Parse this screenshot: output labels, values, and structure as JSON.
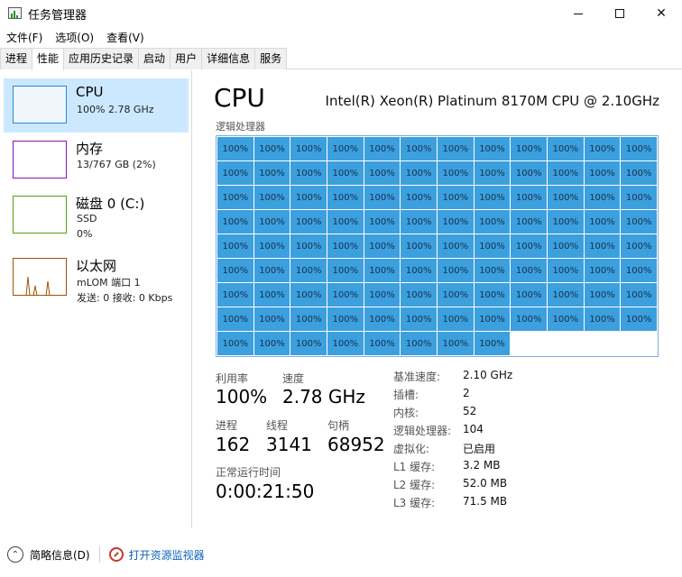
{
  "window": {
    "title": "任务管理器"
  },
  "menu": [
    "文件(F)",
    "选项(O)",
    "查看(V)"
  ],
  "tabs": [
    {
      "label": "进程",
      "active": false
    },
    {
      "label": "性能",
      "active": true
    },
    {
      "label": "应用历史记录",
      "active": false
    },
    {
      "label": "启动",
      "active": false
    },
    {
      "label": "用户",
      "active": false
    },
    {
      "label": "详细信息",
      "active": false
    },
    {
      "label": "服务",
      "active": false
    }
  ],
  "sidebar": {
    "items": [
      {
        "title": "CPU",
        "lines": [
          "100% 2.78 GHz"
        ],
        "selected": true
      },
      {
        "title": "内存",
        "lines": [
          "13/767 GB (2%)"
        ],
        "selected": false
      },
      {
        "title": "磁盘 0 (C:)",
        "lines": [
          "SSD",
          "0%"
        ],
        "selected": false
      },
      {
        "title": "以太网",
        "lines": [
          "mLOM 端口 1",
          "发送: 0  接收: 0 Kbps"
        ],
        "selected": false
      }
    ]
  },
  "main": {
    "title": "CPU",
    "model": "Intel(R) Xeon(R) Platinum 8170M CPU @ 2.10GHz",
    "grid_label": "逻辑处理器",
    "cell_value": "100%",
    "cell_count": 104,
    "grid_color": "#3c9fde",
    "stats": {
      "utilization_label": "利用率",
      "utilization_value": "100%",
      "speed_label": "速度",
      "speed_value": "2.78 GHz",
      "processes_label": "进程",
      "processes_value": "162",
      "threads_label": "线程",
      "threads_value": "3141",
      "handles_label": "句柄",
      "handles_value": "68952",
      "uptime_label": "正常运行时间",
      "uptime_value": "0:00:21:50"
    },
    "specs": [
      {
        "key": "基准速度:",
        "value": "2.10 GHz"
      },
      {
        "key": "插槽:",
        "value": "2"
      },
      {
        "key": "内核:",
        "value": "52"
      },
      {
        "key": "逻辑处理器:",
        "value": "104"
      },
      {
        "key": "虚拟化:",
        "value": "已启用"
      },
      {
        "key": "L1 缓存:",
        "value": "3.2 MB"
      },
      {
        "key": "L2 缓存:",
        "value": "52.0 MB"
      },
      {
        "key": "L3 缓存:",
        "value": "71.5 MB"
      }
    ]
  },
  "footer": {
    "fewer_details": "简略信息(D)",
    "resource_monitor": "打开资源监视器"
  }
}
